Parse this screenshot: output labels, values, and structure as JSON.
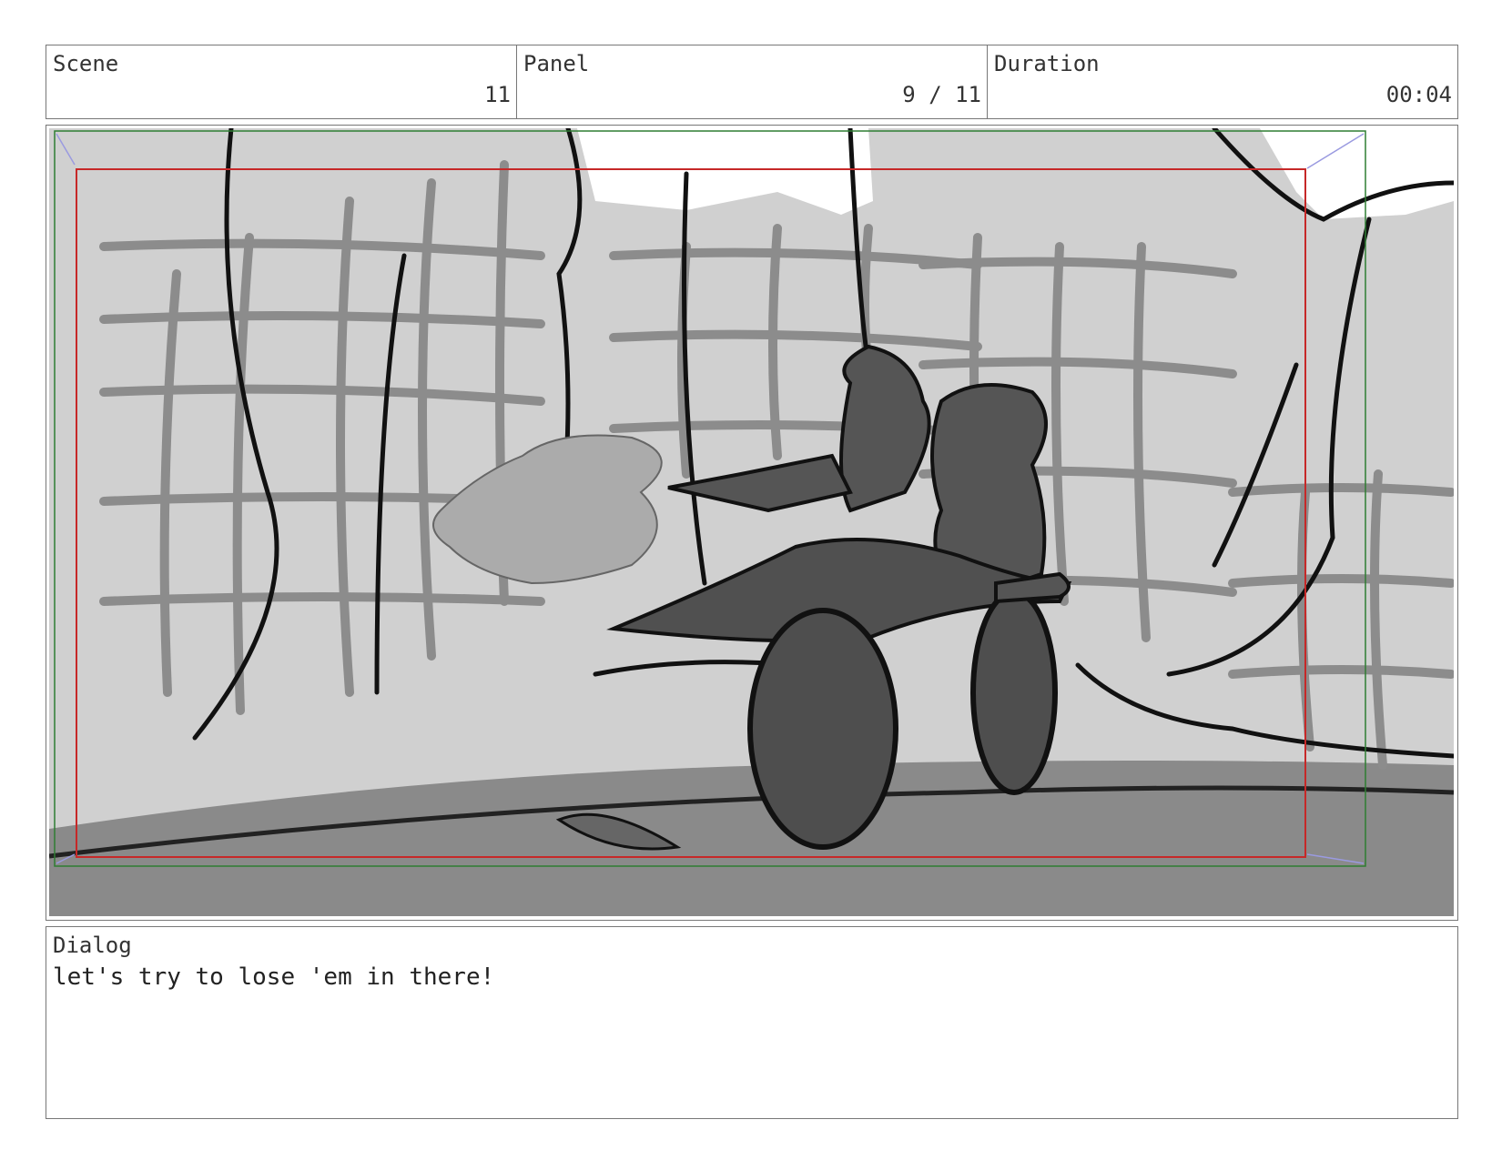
{
  "header": {
    "scene_label": "Scene",
    "scene_value": "11",
    "panel_label": "Panel",
    "panel_value": "9 / 11",
    "duration_label": "Duration",
    "duration_value": "00:04"
  },
  "dialog": {
    "label": "Dialog",
    "text": "let's try to lose 'em in there!"
  },
  "guides": {
    "safe_frame_color": "#2e7d32",
    "action_safe_color": "#c62828",
    "corner_arrow_color": "#9a9ae0"
  }
}
